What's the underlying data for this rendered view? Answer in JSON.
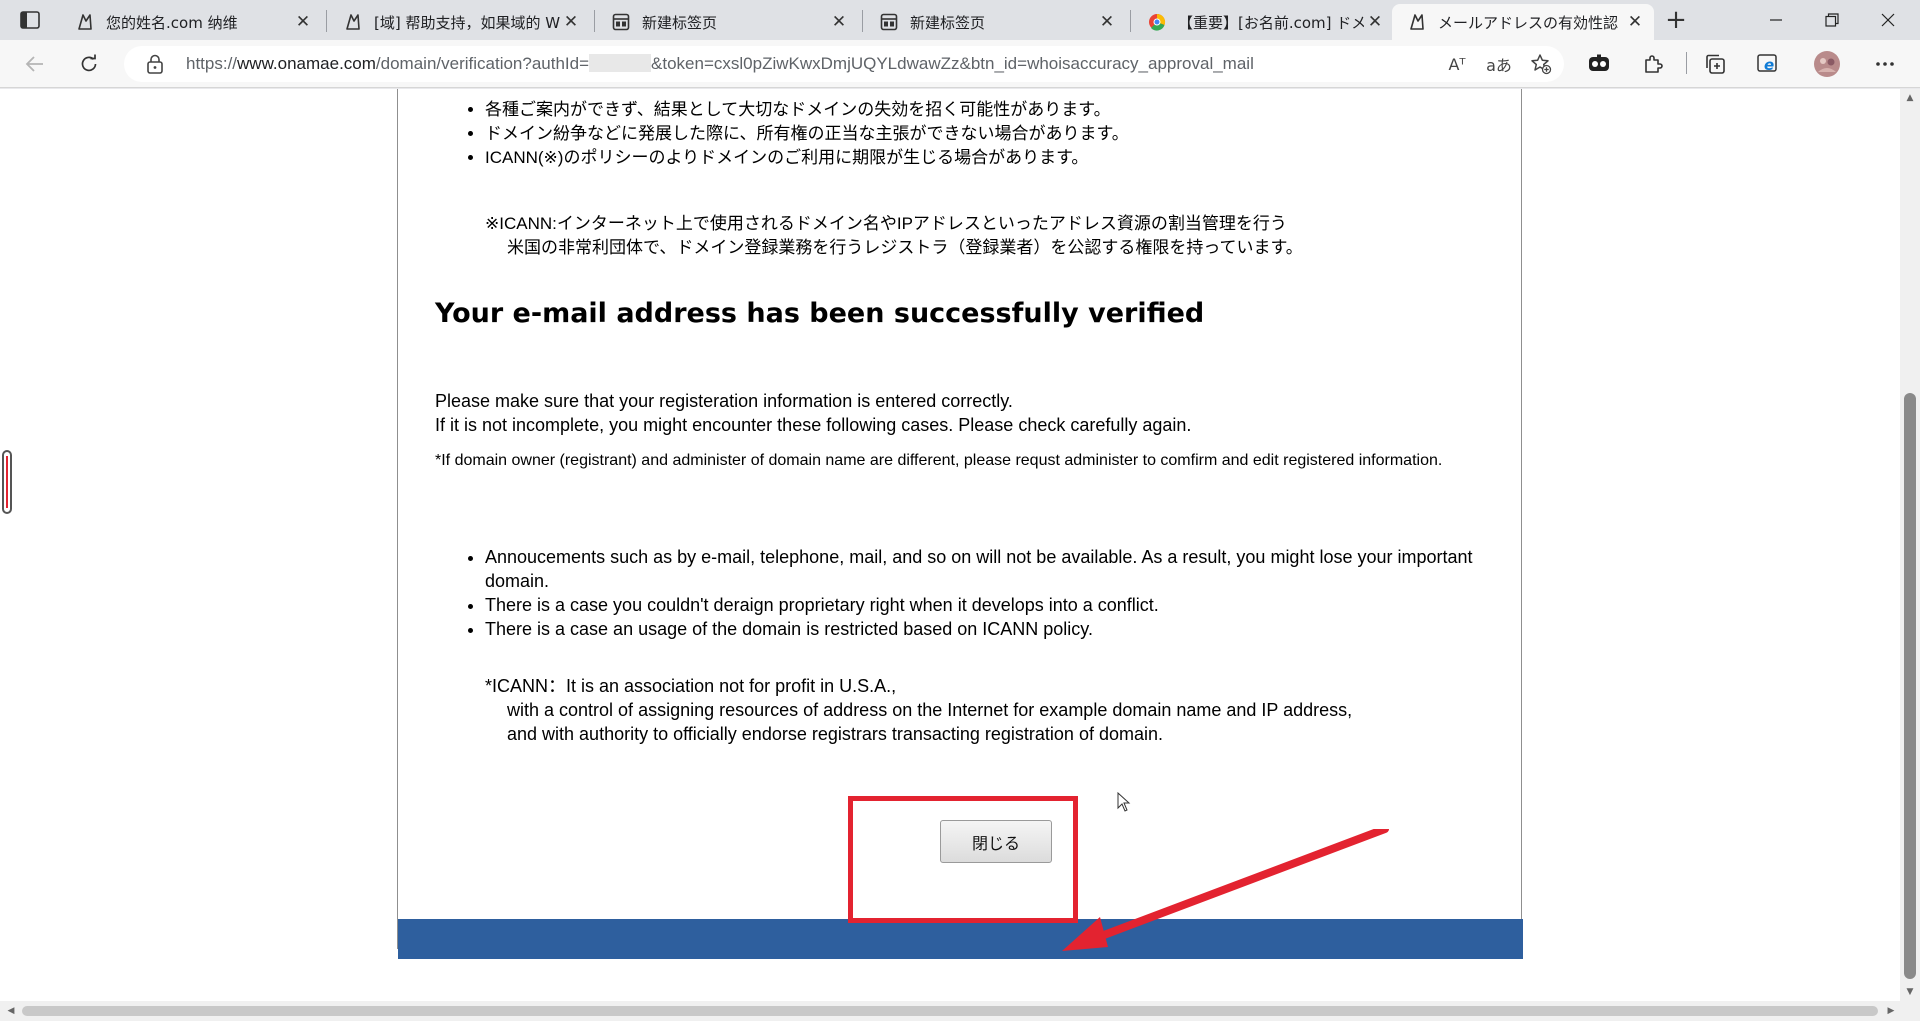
{
  "browser": {
    "tabs": [
      {
        "title": "您的姓名.com 纳维"
      },
      {
        "title": "[域] 帮助支持，如果域的 W"
      },
      {
        "title": "新建标签页"
      },
      {
        "title": "新建标签页"
      },
      {
        "title": "【重要】[お名前.com] ドメ"
      },
      {
        "title": "メールアドレスの有効性認"
      }
    ],
    "url": {
      "prefix": "https://",
      "host": "www.onamae.com",
      "path_a": "/domain/verification?authId=",
      "path_b": "&token=cxsl0pZiwKwxDmjUQYLdwawZz&btn_id=whoisaccuracy_approval_mail"
    },
    "read_aloud_label": "Aᵀ",
    "translate_label": "aあ"
  },
  "page": {
    "jp_bullets": [
      "各種ご案内ができず、結果として大切なドメインの失効を招く可能性があります。",
      "ドメイン紛争などに発展した際に、所有権の正当な主張ができない場合があります。",
      "ICANN(※)のポリシーのよりドメインのご利用に期限が生じる場合があります。"
    ],
    "jp_note_line1": "※ICANN:インターネット上で使用されるドメイン名やIPアドレスといったアドレス資源の割当管理を行う",
    "jp_note_line2": "米国の非常利団体で、ドメイン登録業務を行うレジストラ（登録業者）を公認する権限を持っています。",
    "heading": "Your e-mail address has been successfully verified",
    "para_line1": "Please make sure that your registeration information is entered correctly.",
    "para_line2": "If it is not incomplete,  you might encounter these following cases. Please check carefully again.",
    "admin_note": "*If domain  owner (registrant) and administer of domain name are different, please requst administer to comfirm and edit registered information.",
    "en_bullets": [
      "Annoucements such as by e-mail, telephone, mail, and so on will not be available. As a result, you might lose your important domain.",
      "There is a case you couldn't deraign proprietary right when it develops into a conflict.",
      "There is a case an usage of the domain is restricted based on ICANN policy."
    ],
    "en_note_line1": "*ICANN：It is an association not for profit in U.S.A.,",
    "en_note_line2": "with a control of assigning resources of address on the Internet for example domain name and IP address,",
    "en_note_line3": "and with authority to officially endorse registrars transacting registration of domain.",
    "close_button": "閉じる"
  },
  "colors": {
    "annotation_red": "#e32330",
    "footer_blue": "#2e5f9e"
  }
}
